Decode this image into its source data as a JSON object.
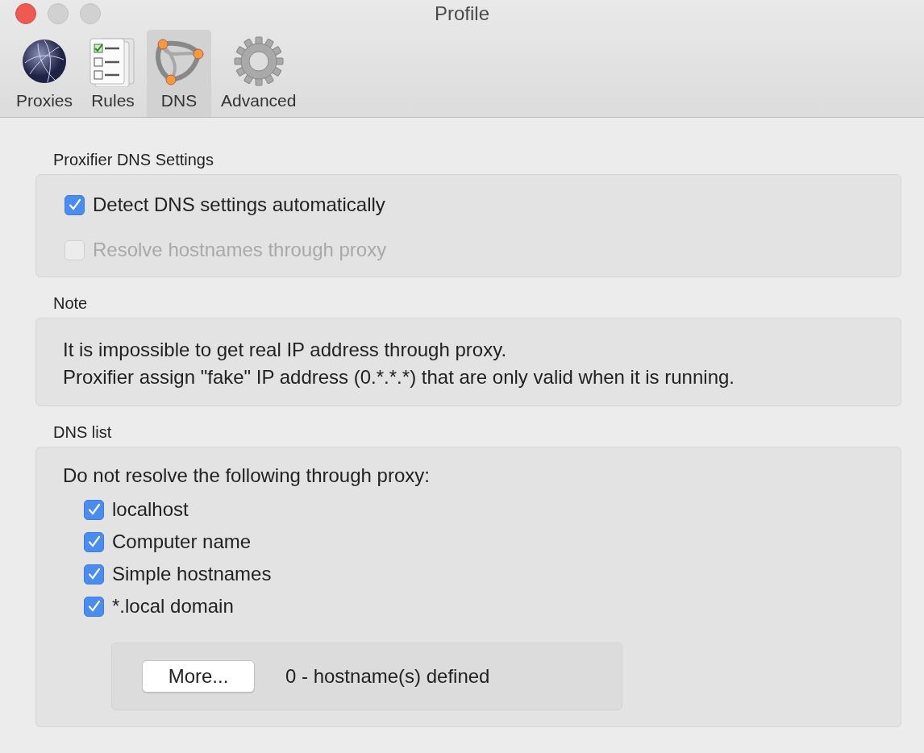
{
  "window": {
    "title": "Profile"
  },
  "tabs": [
    {
      "label": "Proxies",
      "kind": "globe",
      "selected": false
    },
    {
      "label": "Rules",
      "kind": "rules",
      "selected": false
    },
    {
      "label": "DNS",
      "kind": "dns",
      "selected": true
    },
    {
      "label": "Advanced",
      "kind": "gear",
      "selected": false
    }
  ],
  "dns_settings": {
    "title": "Proxifier DNS Settings",
    "options": [
      {
        "label": "Detect DNS settings automatically",
        "checked": true,
        "disabled": false
      },
      {
        "label": "Resolve hostnames through proxy",
        "checked": false,
        "disabled": true
      }
    ]
  },
  "note": {
    "title": "Note",
    "lines": [
      "It is impossible to get real IP address through proxy.",
      "Proxifier assign \"fake\" IP address (0.*.*.*) that are only valid when it is running."
    ]
  },
  "dns_list": {
    "title": "DNS list",
    "intro": "Do not resolve the following through proxy:",
    "items": [
      {
        "label": "localhost",
        "checked": true
      },
      {
        "label": "Computer name",
        "checked": true
      },
      {
        "label": "Simple hostnames",
        "checked": true
      },
      {
        "label": "*.local domain",
        "checked": true
      }
    ],
    "button": "More...",
    "count": "0 - hostname(s) defined"
  }
}
